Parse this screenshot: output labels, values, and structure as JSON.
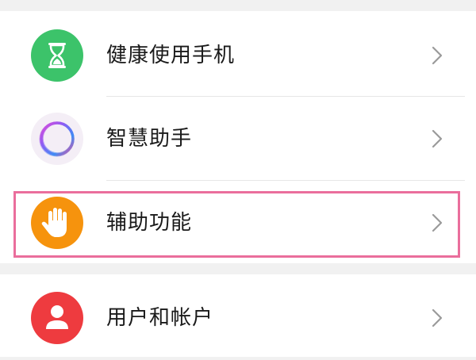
{
  "settings_list": {
    "items": [
      {
        "label": "健康使用手机",
        "icon": "hourglass-icon",
        "icon_color": "#3cc36a"
      },
      {
        "label": "智慧助手",
        "icon": "smart-assistant-ring-icon",
        "icon_color": "#f4eef6"
      },
      {
        "label": "辅助功能",
        "icon": "hand-icon",
        "icon_color": "#f6930d"
      },
      {
        "label": "用户和帐户",
        "icon": "user-icon",
        "icon_color": "#ee3b3f"
      }
    ]
  },
  "highlight": {
    "color": "#ea6e9c",
    "target": "辅助功能"
  }
}
